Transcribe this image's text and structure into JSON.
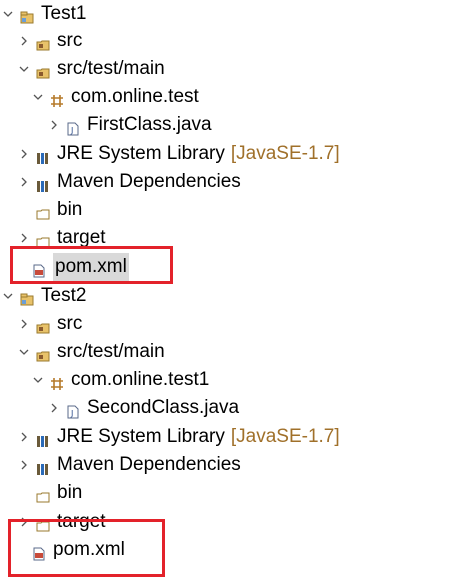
{
  "tree": {
    "projects": [
      {
        "name": "Test1",
        "children": {
          "src": "src",
          "test_source": "src/test/main",
          "package": "com.online.test",
          "class_file": "FirstClass.java",
          "jre": "JRE System Library",
          "jre_version": "[JavaSE-1.7]",
          "maven": "Maven Dependencies",
          "bin": "bin",
          "target": "target",
          "pom": "pom.xml"
        }
      },
      {
        "name": "Test2",
        "children": {
          "src": "src",
          "test_source": "src/test/main",
          "package": "com.online.test1",
          "class_file": "SecondClass.java",
          "jre": "JRE System Library",
          "jre_version": "[JavaSE-1.7]",
          "maven": "Maven Dependencies",
          "bin": "bin",
          "target": "target",
          "pom": "pom.xml"
        }
      }
    ]
  },
  "colors": {
    "highlight": "#e3222a",
    "decorator": "#a0702a",
    "selection": "#d9d9d9"
  },
  "icons": [
    "chevron-down-icon",
    "chevron-right-icon",
    "project-icon",
    "source-folder-icon",
    "package-icon",
    "java-file-icon",
    "library-icon",
    "folder-icon",
    "xml-file-icon"
  ]
}
